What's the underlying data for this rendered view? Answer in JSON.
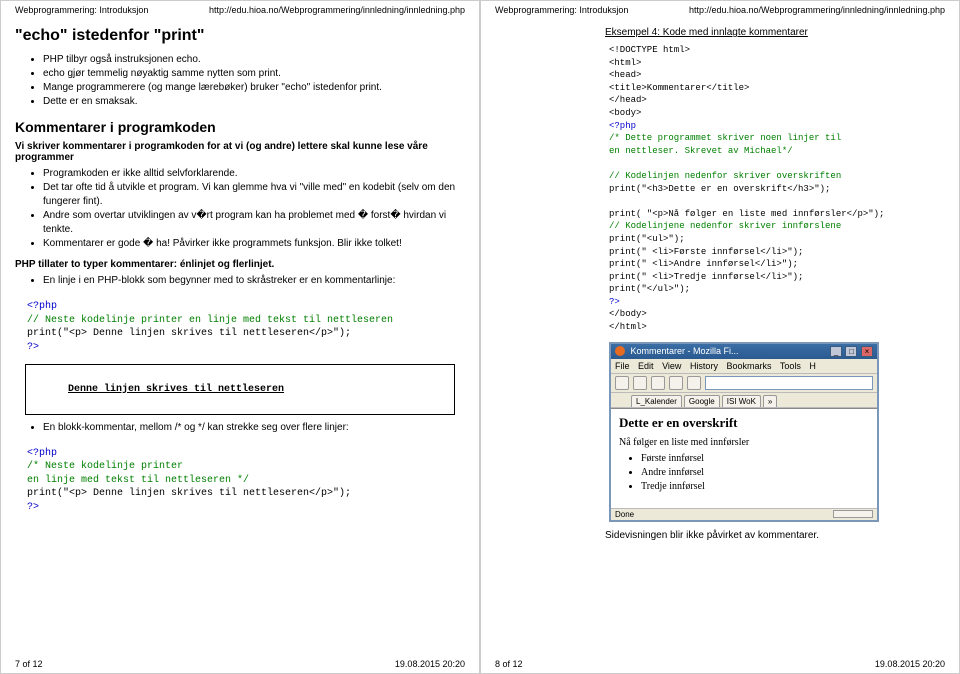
{
  "page_left": {
    "topbar_left": "Webprogrammering: Introduksjon",
    "topbar_right": "http://edu.hioa.no/Webprogrammering/innledning/innledning.php",
    "h2_echo": "\"echo\" istedenfor \"print\"",
    "echo_bullets": [
      "PHP tilbyr også instruksjonen echo.",
      "echo gjør temmelig nøyaktig samme nytten som print.",
      "Mange programmerere (og mange lærebøker) bruker \"echo\" istedenfor print.",
      "Dette er en smaksak."
    ],
    "h3_kommentarer": "Kommentarer i programkoden",
    "comment_intro": "Vi skriver kommentarer i programkoden for at vi (og andre) lettere skal kunne lese våre programmer",
    "comment_bullets": [
      "Programkoden er ikke alltid selvforklarende.",
      "Det tar ofte tid å utvikle et program. Vi kan glemme hva vi \"ville med\" en kodebit (selv om den fungerer fint).",
      "Andre som overtar utviklingen av v�rt program kan ha problemet med � forst� hvirdan vi tenkte.",
      "Kommentarer er gode � ha! Påvirker ikke programmets funksjon. Blir ikke tolket!"
    ],
    "two_types": "PHP tillater to typer kommentarer: énlinjet og flerlinjet.",
    "one_line_bullet": "En linje i en PHP-blokk som begynner med to skråstreker er en kommentarlinje:",
    "code1_open": "<?php",
    "code1_green": "// Neste kodelinje printer en linje med tekst til nettleseren",
    "code1_print": "print(\"<p> Denne linjen skrives til nettleseren</p>\");",
    "code1_close": "?>",
    "framed_line": "Denne linjen skrives til nettleseren",
    "block_comment_text": "En blokk-kommentar, mellom /* og */ kan strekke seg over flere linjer:",
    "code2_open": "<?php",
    "code2_green1": "/* Neste kodelinje printer",
    "code2_green2": "en linje med tekst til nettleseren */",
    "code2_print": "print(\"<p> Denne linjen skrives til nettleseren</p>\");",
    "code2_close": "?>",
    "footer_left": "7 of 12",
    "footer_right": "19.08.2015 20:20"
  },
  "page_right": {
    "topbar_left": "Webprogrammering: Introduksjon",
    "topbar_right": "http://edu.hioa.no/Webprogrammering/innledning/innledning.php",
    "example_title": "Eksempel 4: Kode med innlagte kommentarer",
    "code": {
      "l1": "<!DOCTYPE html>",
      "l2": "<html>",
      "l3": "<head>",
      "l4": "<title>Kommentarer</title>",
      "l5": "</head>",
      "l6": "<body>",
      "l7": "<?php",
      "g1": "/* Dette programmet skriver noen linjer til",
      "g2": "en nettleser. Skrevet av Michael*/",
      "blank1": " ",
      "g3": "// Kodelinjen nedenfor skriver overskriften",
      "p1": "print(\"<h3>Dette er en overskrift</h3>\");",
      "blank2": " ",
      "p2": "print( \"<p>Nå følger en liste med innførsler</p>\");",
      "g4": "// Kodelinjene nedenfor skriver innførslene",
      "p3": "print(\"<ul>\");",
      "p4": "print(\" <li>Første innførsel</li>\");",
      "p5": "print(\" <li>Andre innførsel</li>\");",
      "p6": "print(\" <li>Tredje innførsel</li>\");",
      "p7": "print(\"</ul>\");",
      "l8": "?>",
      "l9": "</body>",
      "l10": "</html>"
    },
    "browser": {
      "title": "Kommentarer - Mozilla Fi...",
      "menu": [
        "File",
        "Edit",
        "View",
        "History",
        "Bookmarks",
        "Tools",
        "H"
      ],
      "tabs": [
        "L_Kalender",
        "Google",
        "ISI WoK",
        "»"
      ],
      "h4": "Dette er en overskrift",
      "p": "Nå følger en liste med innførsler",
      "items": [
        "Første innførsel",
        "Andre innførsel",
        "Tredje innførsel"
      ],
      "status": "Done"
    },
    "closing": "Sidevisningen blir ikke påvirket av kommentarer.",
    "footer_left": "8 of 12",
    "footer_right": "19.08.2015 20:20"
  }
}
